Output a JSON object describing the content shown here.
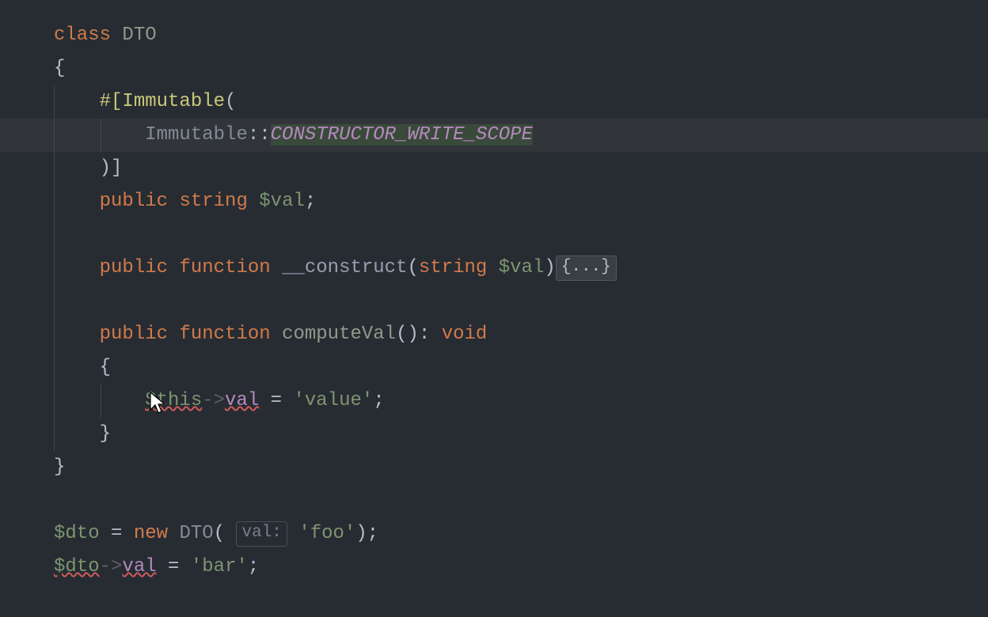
{
  "code": {
    "l1_class": "class",
    "l1_name": "DTO",
    "l2_brace": "{",
    "l3_attr_open": "#[",
    "l3_attr_name": "Immutable",
    "l3_paren": "(",
    "l4_class": "Immutable",
    "l4_scope": "::",
    "l4_const": "CONSTRUCTOR_WRITE_SCOPE",
    "l5_close": ")]",
    "l6_public": "public",
    "l6_type": "string",
    "l6_var": "$val",
    "l6_semi": ";",
    "l8_public": "public",
    "l8_function": "function",
    "l8_name": "__construct",
    "l8_open": "(",
    "l8_ptype": "string",
    "l8_pvar": "$val",
    "l8_close": ")",
    "l8_fold": "{...}",
    "l10_public": "public",
    "l10_function": "function",
    "l10_name": "computeVal",
    "l10_sig": "(): ",
    "l10_ret": "void",
    "l11_brace": "{",
    "l12_this": "$this",
    "l12_arrow": "->",
    "l12_prop": "val",
    "l12_eq": " = ",
    "l12_str": "'value'",
    "l12_semi": ";",
    "l13_brace": "}",
    "l14_brace": "}",
    "l16_var": "$dto",
    "l16_eq": " = ",
    "l16_new": "new",
    "l16_cls": "DTO",
    "l16_open": "(",
    "l16_hint": "val:",
    "l16_str": "'foo'",
    "l16_close": ");",
    "l17_var": "$dto",
    "l17_arrow": "->",
    "l17_prop": "val",
    "l17_eq": " = ",
    "l17_str": "'bar'",
    "l17_semi": ";"
  }
}
